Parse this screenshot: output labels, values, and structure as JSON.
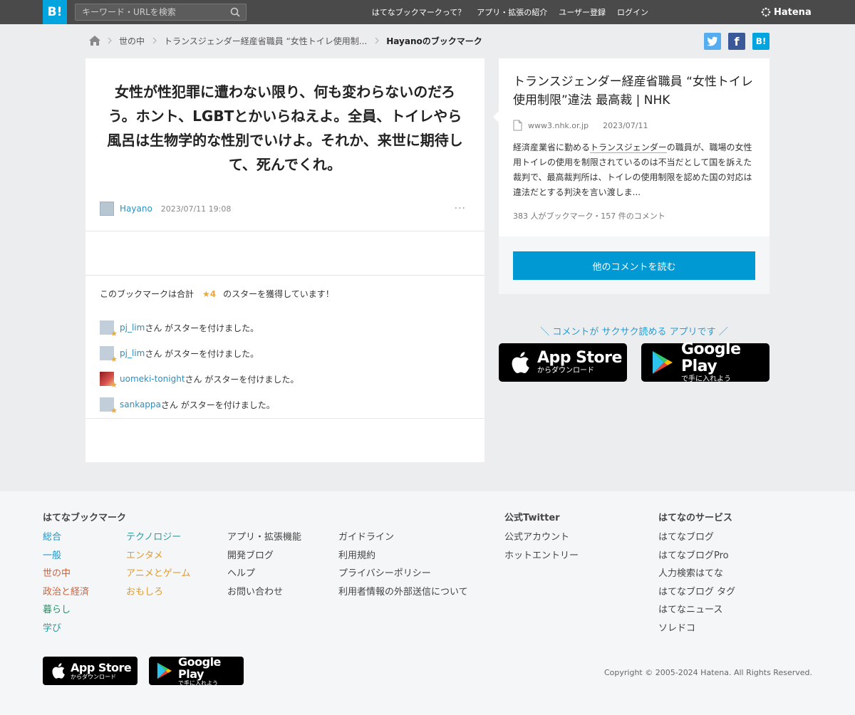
{
  "header": {
    "logo": "B!",
    "search_placeholder": "キーワード・URLを検索",
    "nav": [
      "はてなブックマークって？",
      "アプリ・拡張の紹介",
      "ユーザー登録",
      "ログイン"
    ],
    "brand": "Hatena"
  },
  "breadcrumb": {
    "items": [
      "世の中",
      "トランスジェンダー経産省職員 “女性トイレ使用制..."
    ],
    "current": "Hayanoのブックマーク"
  },
  "share": {
    "facebook": "f",
    "hatena": "B!"
  },
  "bookmark": {
    "comment": "女性が性犯罪に遭わない限り、何も変わらないのだろう。ホント、LGBTとかいらねえよ。全員、トイレやら風呂は生物学的な性別でいけよ。それか、来世に期待して、死んでくれ。",
    "user": "Hayano",
    "timestamp": "2023/07/11 19:08",
    "more": "···"
  },
  "stars": {
    "summary_prefix": "このブックマークは合計",
    "count": "★4",
    "summary_suffix": "のスターを獲得しています！",
    "suffix_text": "さん がスターを付けました。",
    "items": [
      {
        "user": "pj_lim"
      },
      {
        "user": "pj_lim"
      },
      {
        "user": "uomeki-tonight"
      },
      {
        "user": "sankappa"
      }
    ]
  },
  "article": {
    "title": "トランスジェンダー経産省職員 “女性トイレ使用制限”違法 最高裁 | NHK",
    "domain": "www3.nhk.or.jp",
    "date": "2023/07/11",
    "excerpt_pre": "経済産業省に勤める",
    "excerpt_kw": "トランスジェンダー",
    "excerpt_post": "の職員が、職場の女性用トイレの使用を制限されているのは不当だとして国を訴えた裁判で、最高裁判所は、トイレの使用制限を認めた国の対応は違法だとする判決を言い渡しま...",
    "counts": "383 人がブックマーク・157 件のコメント",
    "read_button": "他のコメントを読む"
  },
  "app_promo": {
    "tagline": "＼ コメントが サクサク読める アプリです ／",
    "apple_big": "App Store",
    "apple_small": "からダウンロード",
    "google_big": "Google Play",
    "google_small": "で手に入れよう"
  },
  "footer": {
    "bookmark_title": "はてなブックマーク",
    "col1": [
      "総合",
      "一般",
      "世の中",
      "政治と経済",
      "暮らし",
      "学び"
    ],
    "col2": [
      "テクノロジー",
      "エンタメ",
      "アニメとゲーム",
      "おもしろ"
    ],
    "col3": [
      "アプリ・拡張機能",
      "開発ブログ",
      "ヘルプ",
      "お問い合わせ"
    ],
    "col4": [
      "ガイドライン",
      "利用規約",
      "プライバシーポリシー",
      "利用者情報の外部送信について"
    ],
    "twitter_title": "公式Twitter",
    "twitter_links": [
      "公式アカウント",
      "ホットエントリー"
    ],
    "services_title": "はてなのサービス",
    "services": [
      "はてなブログ",
      "はてなブログPro",
      "人力検索はてな",
      "はてなブログ タグ",
      "はてなニュース",
      "ソレドコ"
    ],
    "copyright": "Copyright © 2005-2024 Hatena. All Rights Reserved."
  },
  "colors": {
    "brand": "#00a4de",
    "header_bg": "#4a4a4a",
    "link": "#2a8fc0",
    "star": "#e9a93f",
    "button": "#0099d3"
  }
}
